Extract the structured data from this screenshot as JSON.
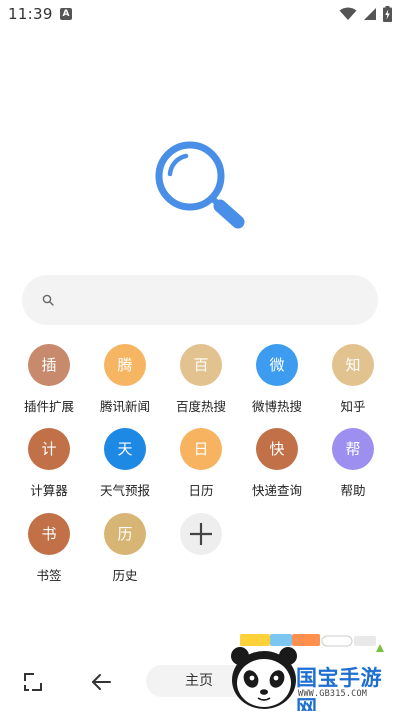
{
  "status_bar": {
    "time": "11:39",
    "notification_glyph": "A",
    "icons": [
      "wifi-icon",
      "signal-icon",
      "battery-charging-icon"
    ]
  },
  "search": {
    "placeholder": "",
    "value": ""
  },
  "shortcuts": [
    {
      "glyph": "插",
      "label": "插件扩展",
      "color": "#c88a6c",
      "icon": "plugin"
    },
    {
      "glyph": "腾",
      "label": "腾讯新闻",
      "color": "#f5b562",
      "icon": "tencent-news"
    },
    {
      "glyph": "百",
      "label": "百度热搜",
      "color": "#e2c38f",
      "icon": "baidu-hot"
    },
    {
      "glyph": "微",
      "label": "微博热搜",
      "color": "#3d9cf0",
      "icon": "weibo-hot"
    },
    {
      "glyph": "知",
      "label": "知乎",
      "color": "#e2c38f",
      "icon": "zhihu"
    },
    {
      "glyph": "计",
      "label": "计算器",
      "color": "#c27048",
      "icon": "calculator"
    },
    {
      "glyph": "天",
      "label": "天气预报",
      "color": "#1e88e5",
      "icon": "weather"
    },
    {
      "glyph": "日",
      "label": "日历",
      "color": "#f7b360",
      "icon": "calendar"
    },
    {
      "glyph": "快",
      "label": "快递查询",
      "color": "#c27048",
      "icon": "express"
    },
    {
      "glyph": "帮",
      "label": "帮助",
      "color": "#9c8ff0",
      "icon": "help"
    },
    {
      "glyph": "书",
      "label": "书签",
      "color": "#c27048",
      "icon": "bookmark"
    },
    {
      "glyph": "历",
      "label": "历史",
      "color": "#d7b574",
      "icon": "history"
    }
  ],
  "add_shortcut": {
    "icon": "plus-icon"
  },
  "bottom_nav": {
    "home_label": "主页"
  },
  "watermark": {
    "name": "国宝手游网",
    "url": "WWW.GB315.COM"
  },
  "colors": {
    "brand_blue": "#4a8fe7",
    "search_bg": "#f3f3f3"
  }
}
